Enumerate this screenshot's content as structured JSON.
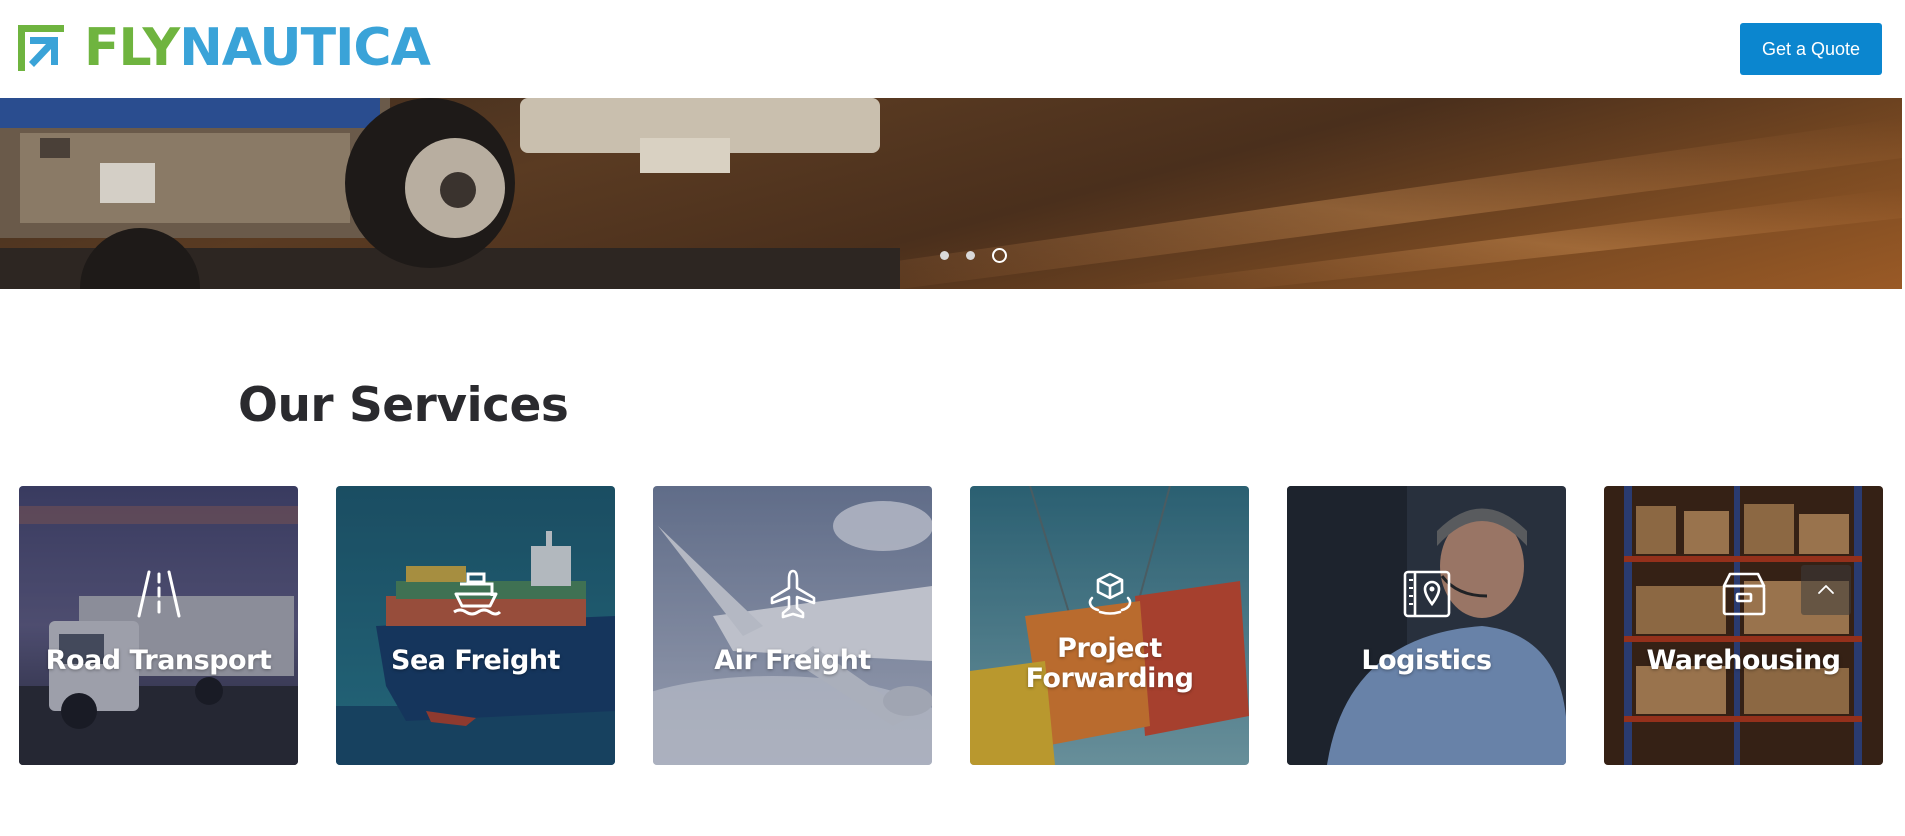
{
  "header": {
    "logo_part1": "FLY",
    "logo_part2": "NAUTICA",
    "quote_button": "Get a Quote"
  },
  "hero": {
    "slides": 3,
    "active_slide": 3
  },
  "services": {
    "title": "Our Services",
    "items": [
      {
        "label": "Road Transport",
        "icon": "road-icon"
      },
      {
        "label": "Sea Freight",
        "icon": "ship-icon"
      },
      {
        "label": "Air Freight",
        "icon": "airplane-icon"
      },
      {
        "label": "Project Forwarding",
        "icon": "package-rotate-icon"
      },
      {
        "label": "Logistics",
        "icon": "map-pin-book-icon"
      },
      {
        "label": "Warehousing",
        "icon": "archive-box-icon"
      }
    ]
  },
  "colors": {
    "logo_green": "#6fb43f",
    "logo_blue": "#3aa3d8",
    "button_blue": "#0b86cf",
    "title_dark": "#2a2a2e"
  },
  "scroll_top_icon": "chevron-up-icon"
}
